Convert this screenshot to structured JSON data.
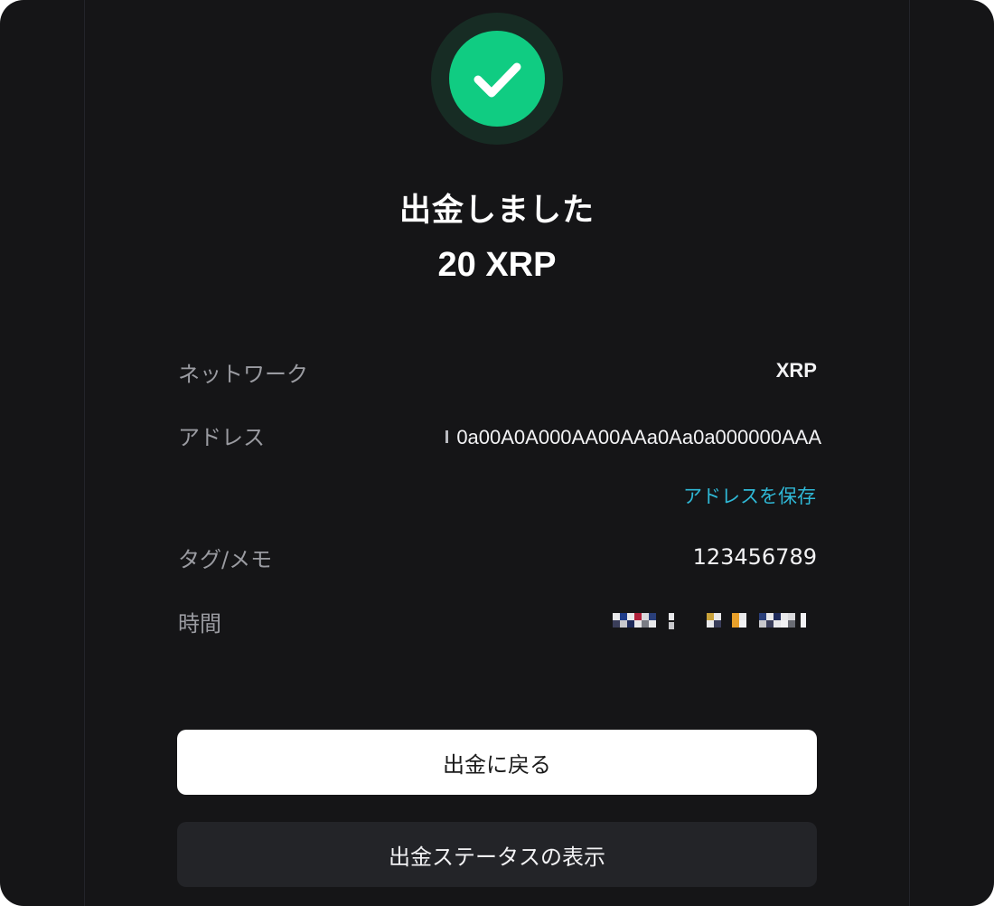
{
  "result": {
    "title": "出金しました",
    "amount": "20 XRP"
  },
  "icons": {
    "status": "check-circle-icon"
  },
  "details": {
    "network_label": "ネットワーク",
    "network_value": "XRP",
    "address_label": "アドレス",
    "address_value": "0a00A0A000AA00AAa0Aa0a000000AAA",
    "save_address_link": "アドレスを保存",
    "tag_label": "タグ/メモ",
    "tag_value": "123456789",
    "time_label": "時間"
  },
  "buttons": {
    "back": "出金に戻る",
    "status": "出金ステータスの表示"
  },
  "colors": {
    "background": "#151517",
    "success": "#10cc82",
    "link": "#2fb8d6",
    "primary_button": "#ffffff",
    "secondary_button": "#232428"
  }
}
